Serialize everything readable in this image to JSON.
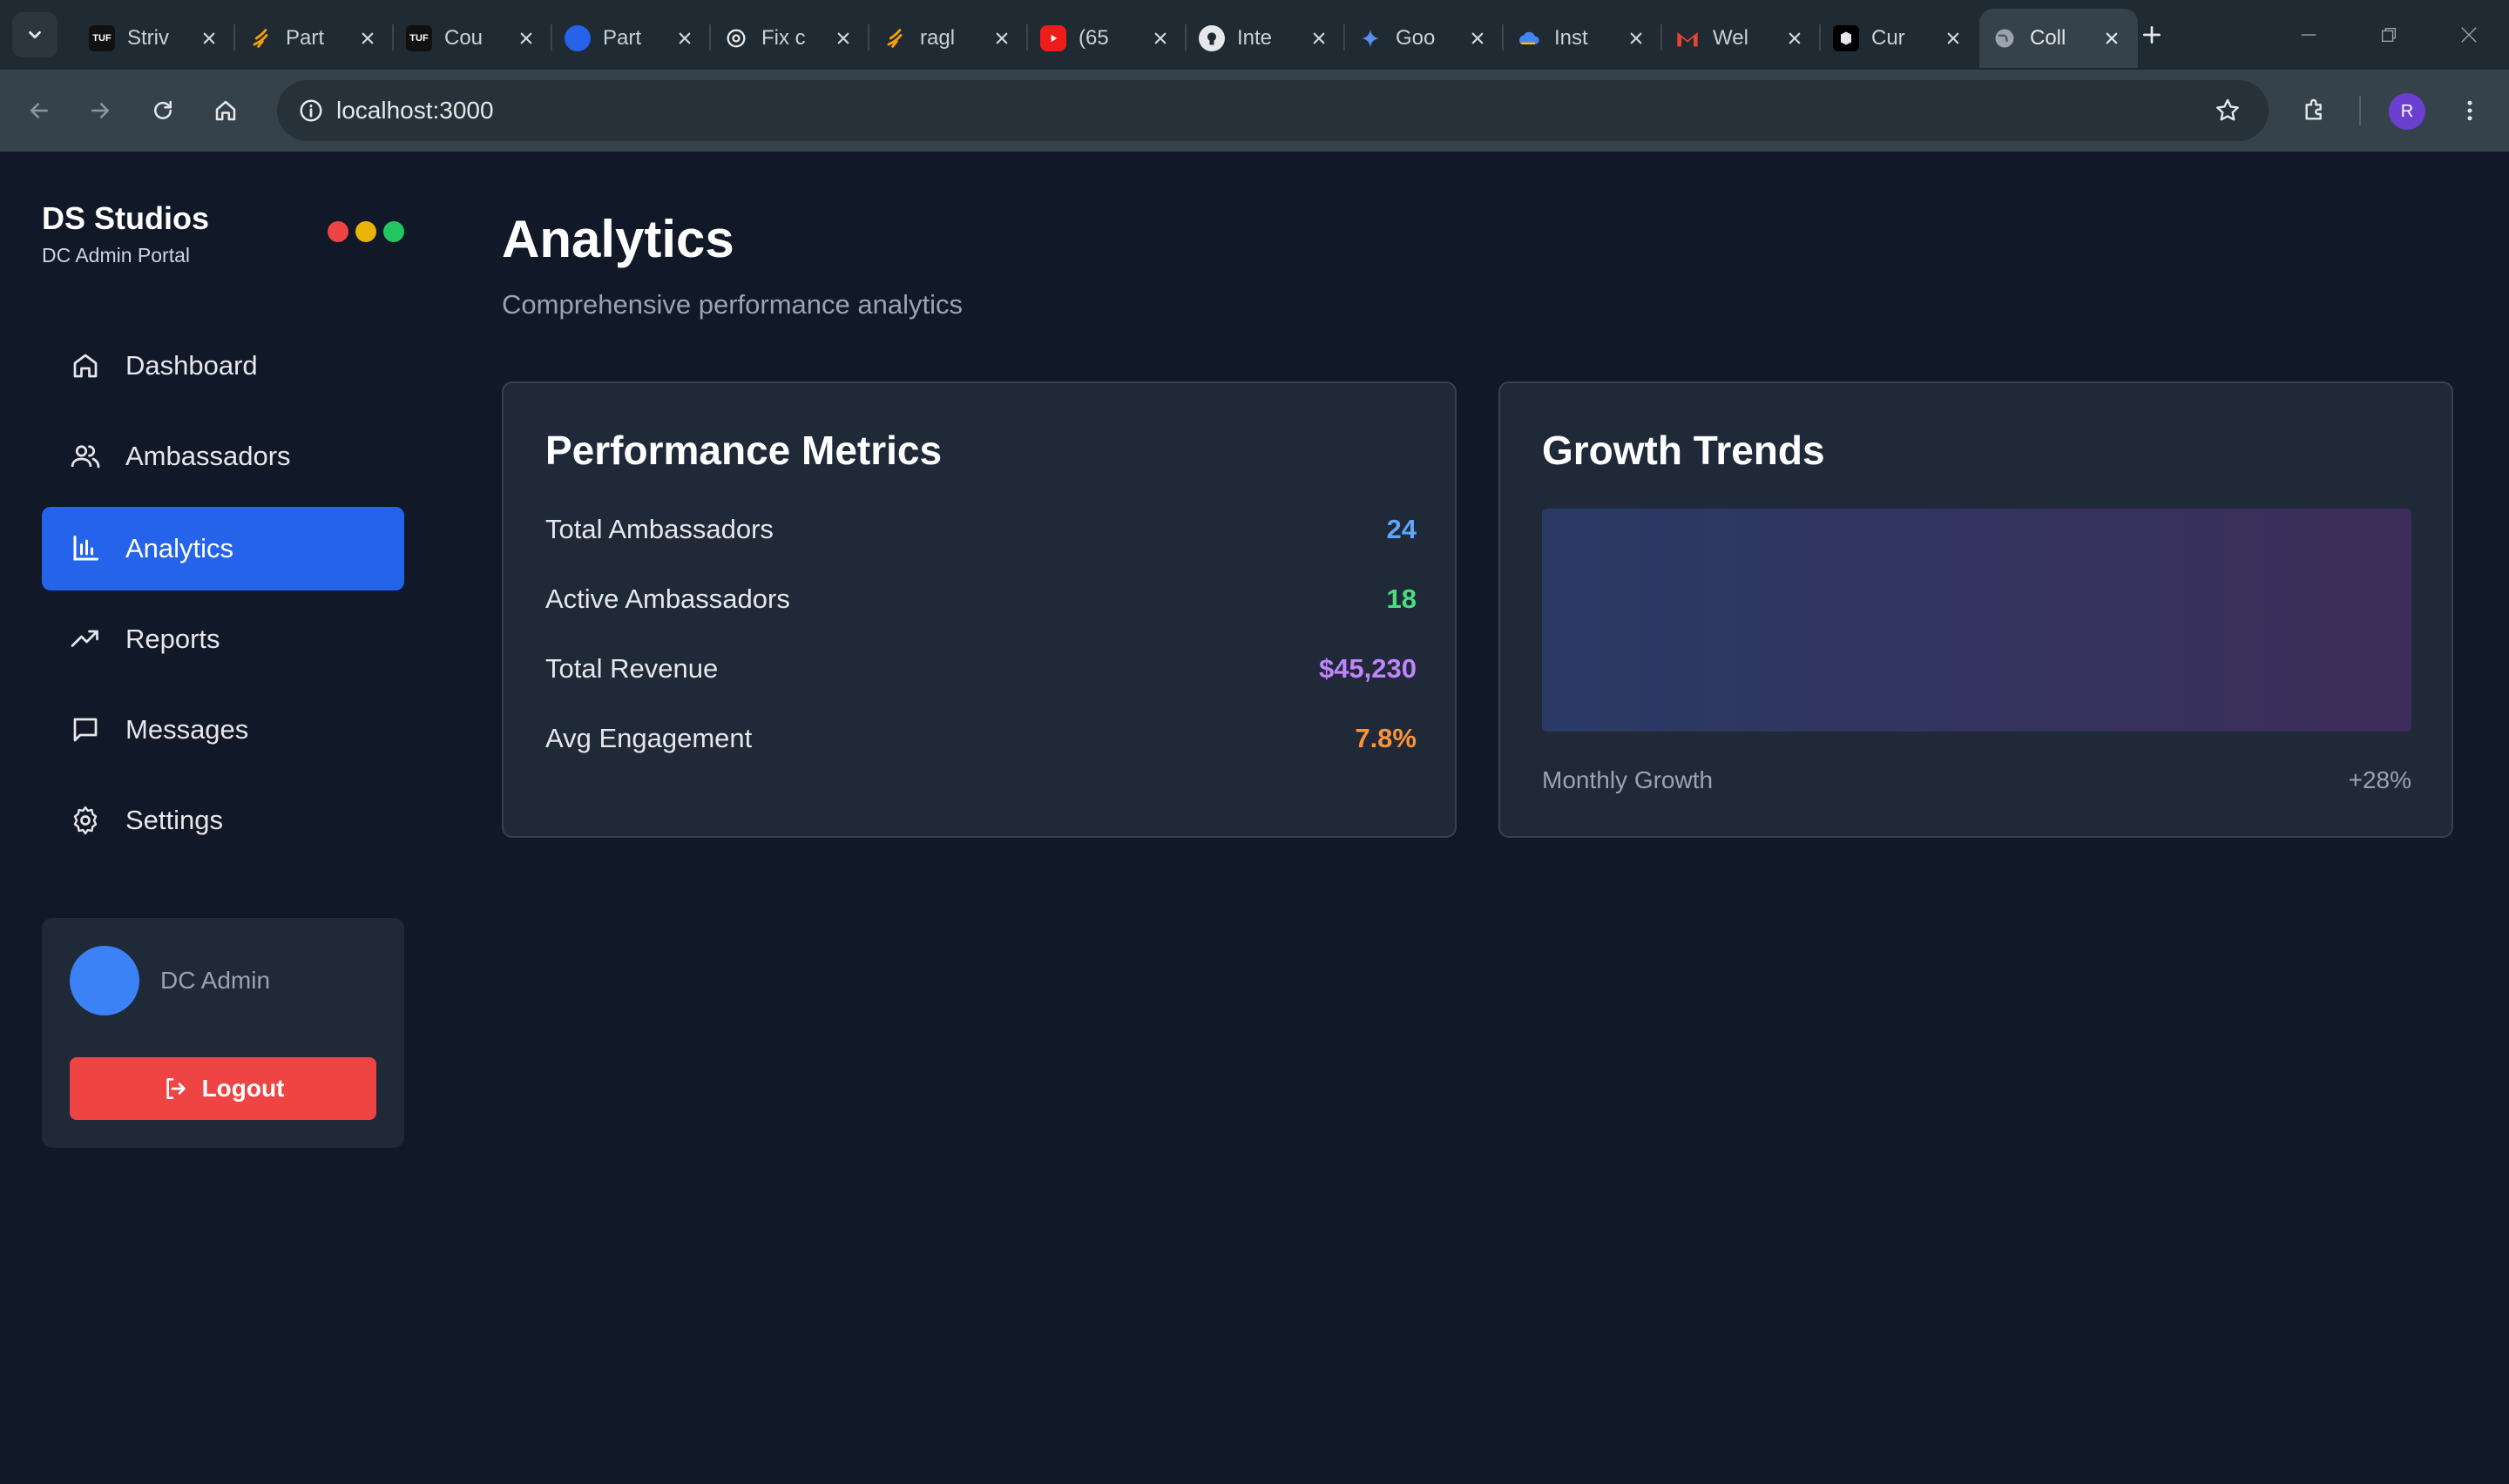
{
  "browser": {
    "tabs": [
      {
        "title": "Striv",
        "icon": "tuf-icon"
      },
      {
        "title": "Part",
        "icon": "swirl-icon"
      },
      {
        "title": "Cou",
        "icon": "tuf-icon"
      },
      {
        "title": "Part",
        "icon": "blue-circle-icon"
      },
      {
        "title": "Fix c",
        "icon": "openai-icon"
      },
      {
        "title": "ragl",
        "icon": "swirl-icon"
      },
      {
        "title": "(65",
        "icon": "youtube-icon"
      },
      {
        "title": "Inte",
        "icon": "github-icon"
      },
      {
        "title": "Goo",
        "icon": "gemini-icon"
      },
      {
        "title": "Inst",
        "icon": "drive-icon"
      },
      {
        "title": "Wel",
        "icon": "gmail-icon"
      },
      {
        "title": "Cur",
        "icon": "cursor-icon"
      },
      {
        "title": "Coll",
        "icon": "globe-icon",
        "active": true
      }
    ],
    "url": "localhost:3000",
    "profile_initial": "R"
  },
  "sidebar": {
    "brand_title": "DS Studios",
    "brand_subtitle": "DC Admin Portal",
    "window_dot_colors": [
      "#ef4444",
      "#eab308",
      "#22c55e"
    ],
    "items": [
      {
        "label": "Dashboard",
        "icon": "home-icon"
      },
      {
        "label": "Ambassadors",
        "icon": "users-icon"
      },
      {
        "label": "Analytics",
        "icon": "bar-chart-icon",
        "active": true
      },
      {
        "label": "Reports",
        "icon": "trending-up-icon"
      },
      {
        "label": "Messages",
        "icon": "message-square-icon"
      },
      {
        "label": "Settings",
        "icon": "gear-icon"
      }
    ],
    "user": {
      "name": "DC Admin"
    },
    "logout_label": "Logout"
  },
  "main": {
    "title": "Analytics",
    "subtitle": "Comprehensive performance analytics",
    "performance": {
      "title": "Performance Metrics",
      "metrics": [
        {
          "label": "Total Ambassadors",
          "value": "24",
          "color": "#60a5fa"
        },
        {
          "label": "Active Ambassadors",
          "value": "18",
          "color": "#4ade80"
        },
        {
          "label": "Total Revenue",
          "value": "$45,230",
          "color": "#c084fc"
        },
        {
          "label": "Avg Engagement",
          "value": "7.8%",
          "color": "#fb923c"
        }
      ]
    },
    "growth": {
      "title": "Growth Trends",
      "footer_label": "Monthly Growth",
      "footer_value": "+28%"
    }
  },
  "colors": {
    "accent": "#2563eb",
    "logout": "#ef4444",
    "avatar": "#3b82f6"
  }
}
